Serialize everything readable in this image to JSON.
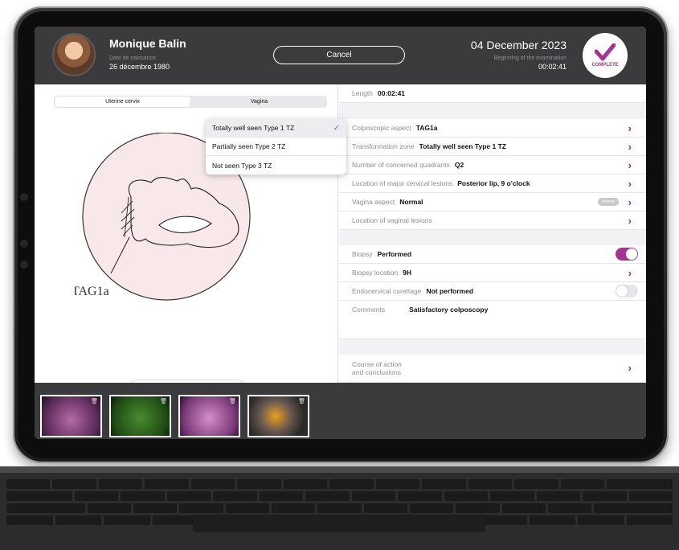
{
  "header": {
    "patient_name": "Monique Balin",
    "dob_label": "Date de naissance",
    "dob": "26 décembre 1980",
    "cancel_label": "Cancel",
    "exam_date": "04 December 2023",
    "exam_begin_label": "Beginning of the examination",
    "exam_time": "00:02:41",
    "status_badge": "COMPLETE"
  },
  "tabs": [
    {
      "label": "Uterine cervix",
      "selected": true
    },
    {
      "label": "Vagina",
      "selected": false
    }
  ],
  "drawing": {
    "annotation": "TAG1a"
  },
  "tools": [
    {
      "icon": "pen-off-icon"
    },
    {
      "icon": "black-color-icon",
      "color": "#000000"
    },
    {
      "icon": "blue-color-icon",
      "color": "#5ac8fa"
    },
    {
      "icon": "red-color-icon",
      "color": "#e5232b"
    },
    {
      "icon": "eraser-icon"
    }
  ],
  "dropdown": {
    "options": [
      "Totally well seen Type 1 TZ",
      "Partially seen Type 2 TZ",
      "Not seen Type 3 TZ"
    ],
    "selected": "Totally well seen Type 1 TZ"
  },
  "fields": {
    "length_label": "Length",
    "length_value": "00:02:41",
    "colpo_label": "Colposcopic aspect",
    "colpo_value": "TAG1a",
    "tz_label": "Transformation zone",
    "tz_value": "Totally well seen Type 1 TZ",
    "quad_label": "Number of concerned quadrants",
    "quad_value": "Q2",
    "loc_label": "Location of major cervical lesions",
    "loc_value": "Posterior lip, 9 o'clock",
    "vag_label": "Vagina aspect",
    "vag_value": "Normal",
    "vag_pill": "Normal",
    "vagloc_label": "Location of vaginal lesions",
    "biopsy_label": "Biopsy",
    "biopsy_value": "Performed",
    "biopsy_on": true,
    "bloc_label": "Biopsy location",
    "bloc_value": "9H",
    "endo_label": "Endocervical curettage",
    "endo_value": "Not performed",
    "endo_on": false,
    "comments_label": "Comments",
    "comments_value": "Satisfactory colposcopy",
    "course_label_1": "Course of action",
    "course_label_2": "and conclusions"
  },
  "colors": {
    "accent": "#a5338f",
    "header": "#3b3b3d",
    "check": "#2f7cf6"
  }
}
